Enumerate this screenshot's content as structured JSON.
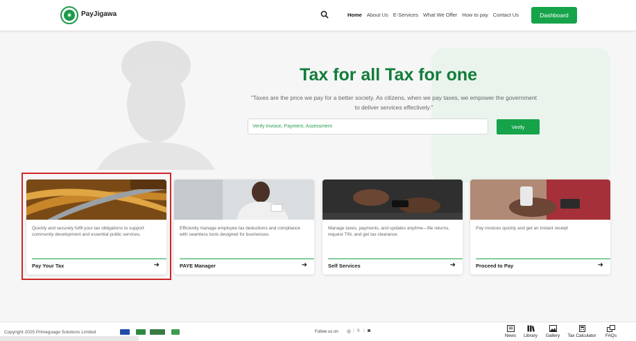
{
  "header": {
    "brand": "PayJigawa",
    "nav": [
      "Home",
      "About Us",
      "E-Services",
      "What We Offer",
      "How to pay",
      "Contact Us"
    ],
    "active_nav": "Home",
    "dashboard_label": "Dashboard"
  },
  "hero": {
    "title": "Tax for all Tax for one",
    "quote": "\"Taxes are the price we pay for a better society. As citizens, when we pay taxes, we empower the government to deliver services effectively.\"",
    "verify_placeholder": "Verify Invoice, Payment, Assessment",
    "verify_label": "Verify"
  },
  "cards": [
    {
      "label": "Pay Your Tax",
      "desc": "Quickly and securely fulfil your tax obligations to support community development and essential public services."
    },
    {
      "label": "PAYE Manager",
      "desc": "Efficiently manage employee tax deductions and compliance with seamless tools designed for businesses."
    },
    {
      "label": "Self Services",
      "desc": "Manage taxes, payments, and updates anytime—file returns, request TIN, and get tax clearance."
    },
    {
      "label": "Proceed to Pay",
      "desc": "Pay invoices quickly and get an instant receipt"
    }
  ],
  "footer": {
    "copyright": "Copyright 2025 Primeguage Solutions Limited",
    "follow": "Follow us on",
    "links": [
      "News",
      "Library",
      "Gallery",
      "Tax Calculator",
      "FAQs"
    ]
  },
  "colors": {
    "accent": "#16a34a",
    "title": "#127c3a",
    "highlight": "#d02626"
  }
}
